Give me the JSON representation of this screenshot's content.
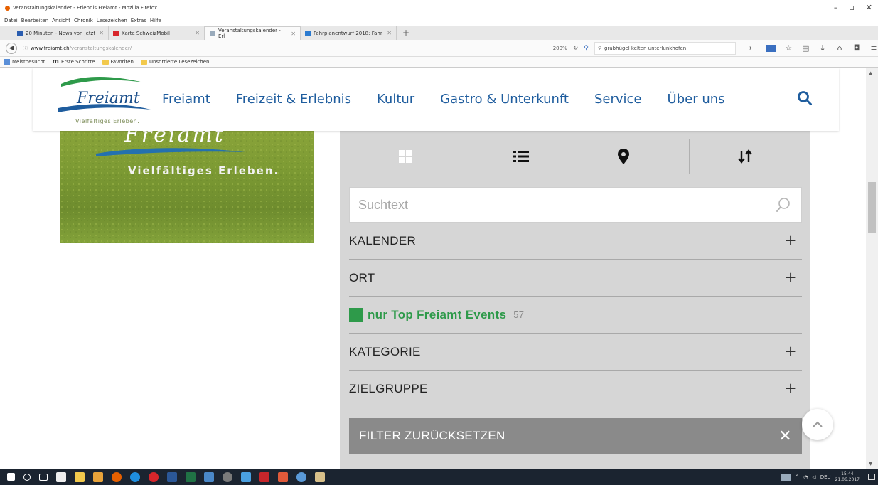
{
  "window": {
    "title": "Veranstaltungskalender - Erlebnis Freiamt - Mozilla Firefox",
    "controls": [
      "–",
      "▫",
      "✕"
    ]
  },
  "menu": [
    "Datei",
    "Bearbeiten",
    "Ansicht",
    "Chronik",
    "Lesezeichen",
    "Extras",
    "Hilfe"
  ],
  "tabs": [
    {
      "label": "20 Minuten - News von jetzt",
      "active": false,
      "icon_color": "#2a5db0"
    },
    {
      "label": "Karte SchweizMobil",
      "active": false,
      "icon_color": "#d8262b"
    },
    {
      "label": "Veranstaltungskalender - Erl",
      "active": true,
      "icon_color": "#9ab"
    },
    {
      "label": "Fahrplanentwurf 2018: Fahr",
      "active": false,
      "icon_color": "#2a7ad0"
    }
  ],
  "tab_new": "+",
  "navbar": {
    "url_domain": "www.freiamt.ch",
    "url_path": "/veranstaltungskalender/",
    "zoom": "200%",
    "search_value": "grabhügel kelten unterlunkhofen"
  },
  "bookmarks": [
    "Meistbesucht",
    "Erste Schritte",
    "Favoriten",
    "Unsortierte Lesezeichen"
  ],
  "site": {
    "logo_text": "Freiamt",
    "logo_tagline": "Vielfältiges Erleben.",
    "nav": [
      "Freiamt",
      "Freizeit & Erlebnis",
      "Kultur",
      "Gastro & Unterkunft",
      "Service",
      "Über uns"
    ],
    "brand_blue": "#1f5d9e",
    "brand_green": "#2e9a4a"
  },
  "hero": {
    "script": "Freiamt",
    "tagline": "Vielfältiges Erleben."
  },
  "filters": {
    "views": [
      "grid-view",
      "list-view",
      "map-view",
      "sort"
    ],
    "search_placeholder": "Suchtext",
    "rows": [
      {
        "label": "KALENDER",
        "expand": "+"
      },
      {
        "label": "ORT",
        "expand": "+"
      },
      {
        "label": "KATEGORIE",
        "expand": "+"
      },
      {
        "label": "ZIELGRUPPE",
        "expand": "+"
      }
    ],
    "top_events_label": "nur Top Freiamt Events",
    "top_events_count": "57",
    "reset_label": "FILTER ZURÜCKSETZEN",
    "reset_icon": "✕"
  },
  "taskbar": {
    "lang": "DEU",
    "time": "15:44",
    "date": "21.06.2017"
  }
}
